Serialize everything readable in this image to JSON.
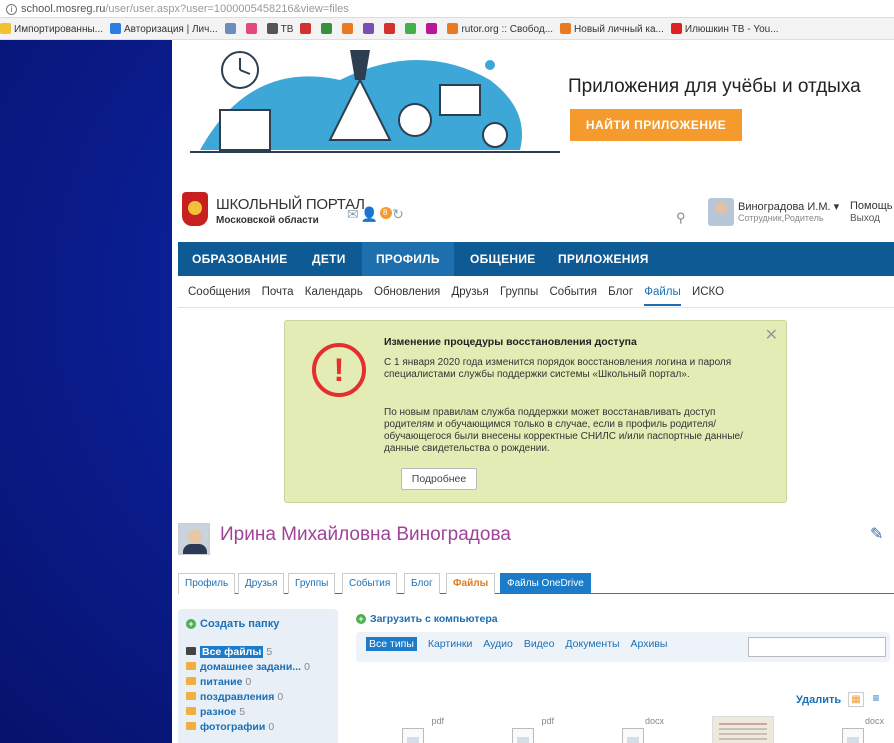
{
  "browser": {
    "url_host": "school.mosreg.ru",
    "url_path": "/user/user.aspx?user=1000005458216&view=files",
    "bookmarks": [
      {
        "label": "Импортированны...",
        "color": "#f3c12f"
      },
      {
        "label": "Авторизация | Лич...",
        "color": "#2a7de1"
      },
      {
        "label": "",
        "color": "#6c8ebf"
      },
      {
        "label": "",
        "color": "#e24a7c"
      },
      {
        "label": "ТВ",
        "color": "#555555"
      },
      {
        "label": "",
        "color": "#d2322d"
      },
      {
        "label": "",
        "color": "#3a8f3a"
      },
      {
        "label": "",
        "color": "#e77a22"
      },
      {
        "label": "",
        "color": "#7a4fb5"
      },
      {
        "label": "",
        "color": "#d2322d"
      },
      {
        "label": "",
        "color": "#43b04a"
      },
      {
        "label": "",
        "color": "#c0139b"
      },
      {
        "label": "rutor.org :: Свобод...",
        "color": "#e77a22"
      },
      {
        "label": "Новый личный ка...",
        "color": "#e77a22"
      },
      {
        "label": "Илюшкин ТВ - You...",
        "color": "#e02020"
      }
    ]
  },
  "hero": {
    "title": "Приложения для учёбы и отдыха",
    "button": "НАЙТИ ПРИЛОЖЕНИЕ"
  },
  "header": {
    "logo_line1": "ШКОЛЬНЫЙ ПОРТАЛ",
    "logo_line2": "Московской области",
    "notif_badge": "8",
    "user_name": "Виноградова И.М.",
    "user_role": "Сотрудник,Родитель",
    "help": "Помощь",
    "logout": "Выход"
  },
  "nav": {
    "items": [
      "ОБРАЗОВАНИЕ",
      "ДЕТИ",
      "ПРОФИЛЬ",
      "ОБЩЕНИЕ",
      "ПРИЛОЖЕНИЯ"
    ]
  },
  "subnav": {
    "items": [
      "Сообщения",
      "Почта",
      "Календарь",
      "Обновления",
      "Друзья",
      "Группы",
      "События",
      "Блог",
      "Файлы",
      "ИСКО"
    ]
  },
  "notice": {
    "title": "Изменение процедуры восстановления доступа",
    "p1": "С 1 января 2020 года изменится порядок восстановления логина и пароля специалистами службы поддержки системы «Школьный портал».",
    "p2": "По новым правилам служба поддержки может восстанавливать доступ родителям и обучающимся только в случае, если в профиль родителя/обучающегося были внесены корректные СНИЛС и/или паспортные данные/данные свидетельства о рождении.",
    "more": "Подробнее"
  },
  "profile": {
    "name": "Ирина Михайловна Виноградова",
    "tabs": [
      "Профиль",
      "Друзья",
      "Группы",
      "События",
      "Блог",
      "Файлы",
      "Файлы OneDrive"
    ]
  },
  "files": {
    "create_folder": "Создать папку",
    "upload": "Загрузить с компьютера",
    "folders": [
      {
        "label": "Все файлы",
        "count": "5"
      },
      {
        "label": "домашнее задани...",
        "count": "0"
      },
      {
        "label": "питание",
        "count": "0"
      },
      {
        "label": "поздравления",
        "count": "0"
      },
      {
        "label": "разное",
        "count": "5"
      },
      {
        "label": "фотографии",
        "count": "0"
      }
    ],
    "type_filters": [
      "Все типы",
      "Картинки",
      "Аудио",
      "Видео",
      "Документы",
      "Архивы"
    ],
    "delete": "Удалить",
    "items": [
      {
        "ext": "pdf"
      },
      {
        "ext": "pdf"
      },
      {
        "ext": "docx"
      },
      {
        "ext": ""
      },
      {
        "ext": "docx"
      }
    ]
  }
}
